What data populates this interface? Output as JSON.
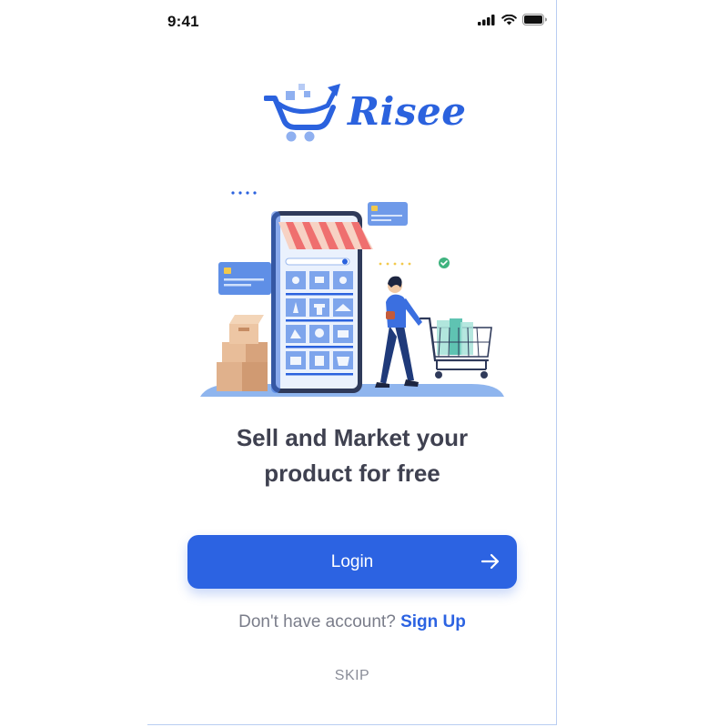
{
  "status_bar": {
    "time": "9:41",
    "icons": [
      "signal-icon",
      "wifi-icon",
      "battery-icon"
    ]
  },
  "logo": {
    "text": "Risee",
    "icon": "shopping-cart-arrow-icon"
  },
  "headline": {
    "line1": "Sell and Market your",
    "line2": "product for free"
  },
  "login_button": {
    "label": "Login",
    "icon": "arrow-right-icon"
  },
  "signup": {
    "prompt": "Don't have account?",
    "link": "Sign Up"
  },
  "skip": "SKIP",
  "colors": {
    "primary": "#2c63e2",
    "text_dark": "#3f4150",
    "text_muted": "#7a7d8a",
    "awning_red": "#ef6f6f",
    "box_brown": "#e2b08a"
  }
}
